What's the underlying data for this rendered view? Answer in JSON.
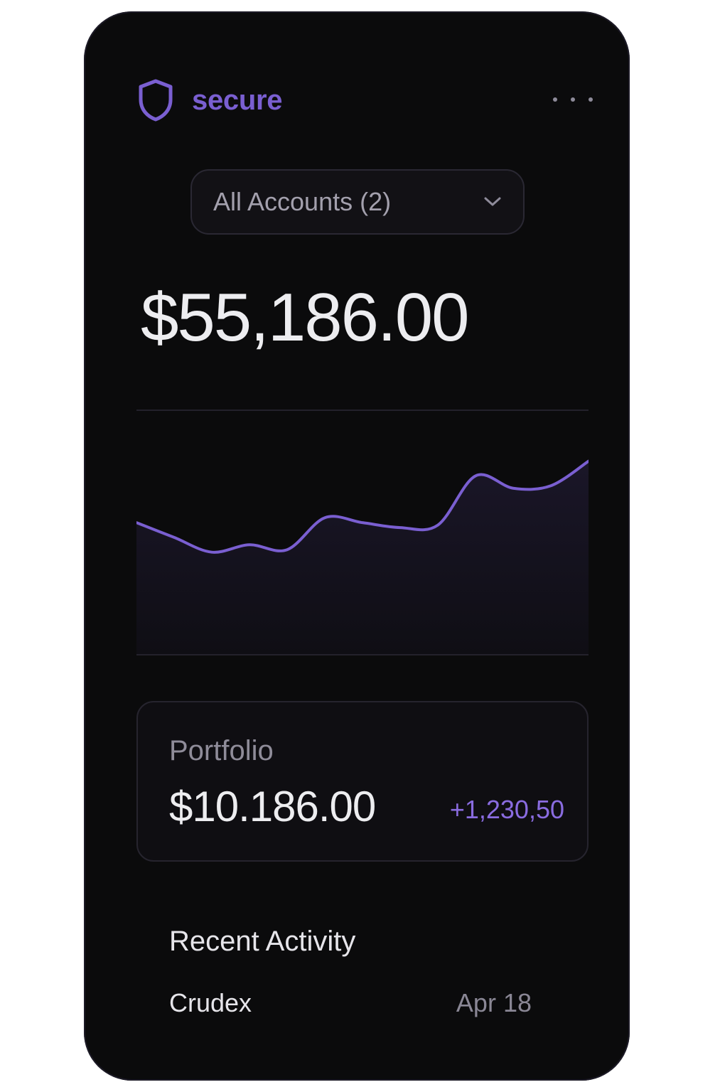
{
  "brand": {
    "name": "secure",
    "icon": "shield-icon",
    "accent_color": "#7a5fd1"
  },
  "header": {
    "menu_icon": "more-horizontal-icon"
  },
  "account_selector": {
    "label": "All Accounts (2)",
    "icon": "chevron-down-icon"
  },
  "balance": {
    "total": "$55,186.00"
  },
  "chart_data": {
    "type": "line",
    "x": [
      0,
      1,
      2,
      3,
      4,
      5,
      6,
      7,
      8,
      9,
      10,
      11,
      12
    ],
    "series": [
      {
        "values": [
          54,
          48,
          42,
          45,
          43,
          56,
          54,
          52,
          53,
          73,
          68,
          69,
          79
        ]
      }
    ],
    "ylim": [
      0,
      100
    ],
    "line_color": "#7a5fd1",
    "grid": false
  },
  "portfolio": {
    "label": "Portfolio",
    "value": "$10.186.00",
    "change": "+1,230,50",
    "change_color": "#8a6ce0"
  },
  "recent_activity": {
    "title": "Recent Activity",
    "items": [
      {
        "name": "Crudex",
        "date": "Apr 18"
      }
    ]
  }
}
